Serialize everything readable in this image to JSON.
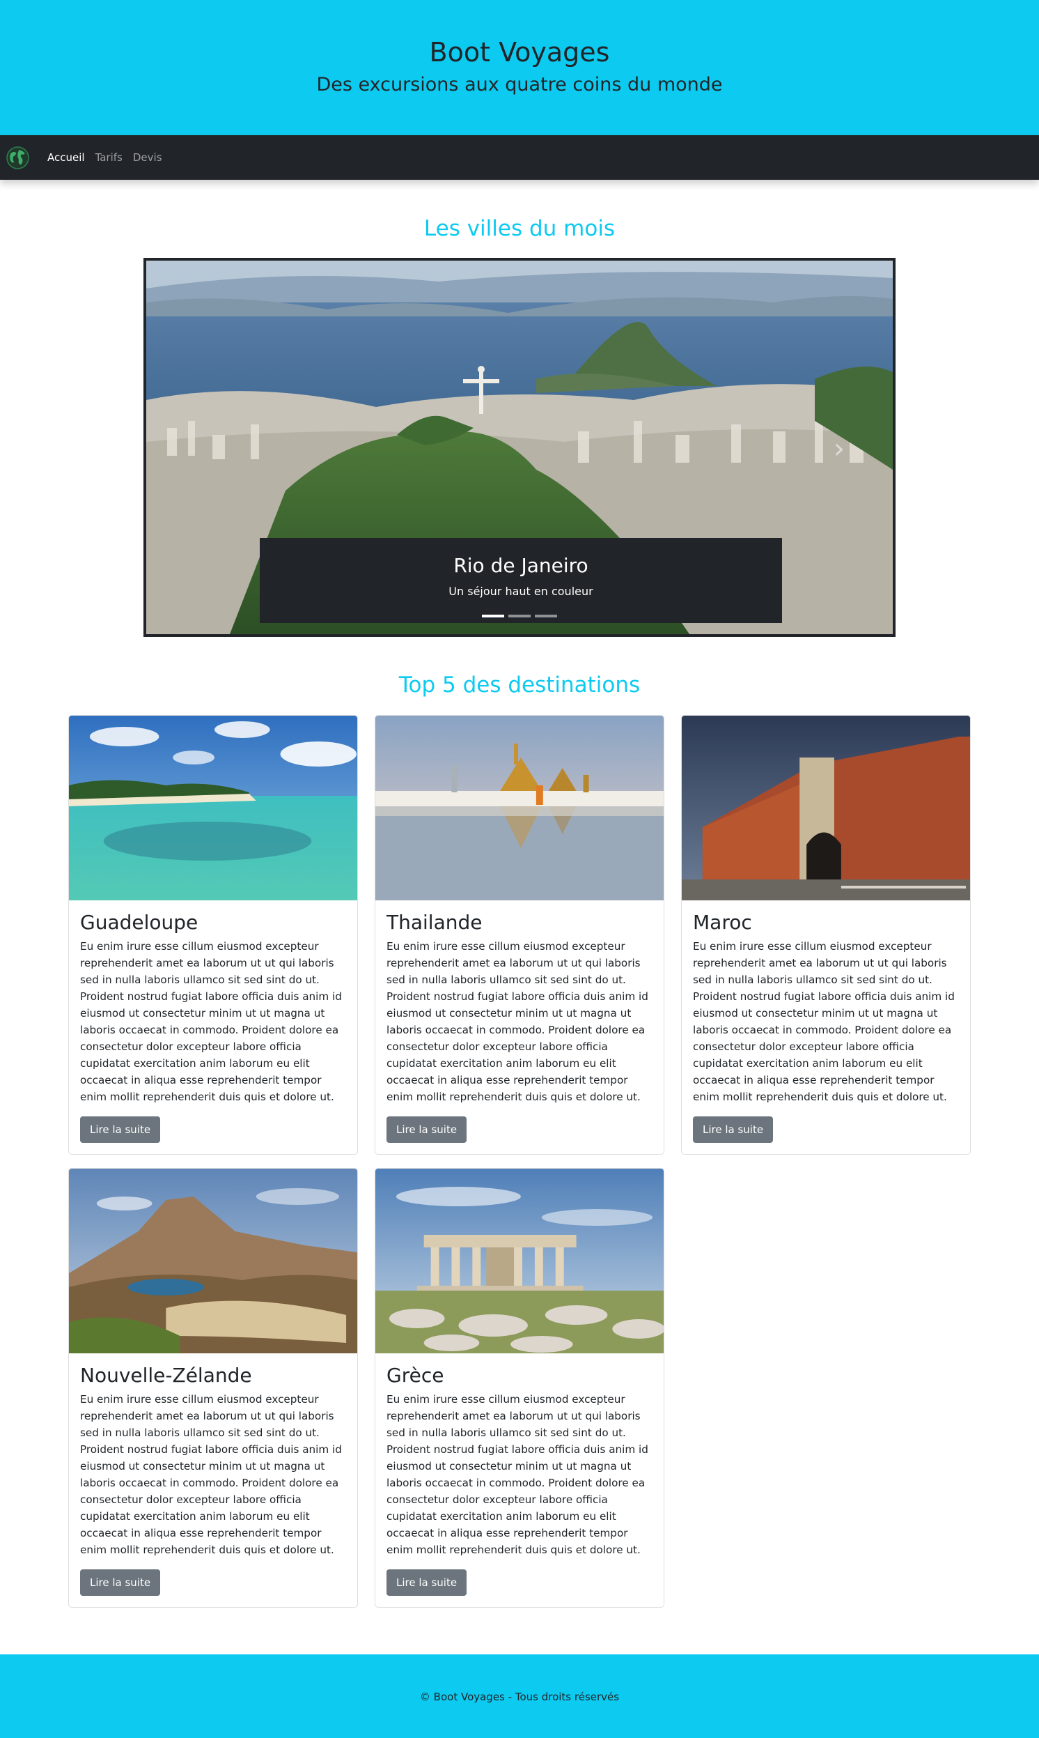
{
  "header": {
    "title": "Boot Voyages",
    "subtitle": "Des excursions aux quatre coins du monde"
  },
  "navbar": {
    "brand_icon": "globe-icon",
    "links": [
      {
        "label": "Accueil",
        "active": true
      },
      {
        "label": "Tarifs",
        "active": false
      },
      {
        "label": "Devis",
        "active": false
      }
    ]
  },
  "carousel_section": {
    "title": "Les villes du mois",
    "slide": {
      "image": "rio-de-janeiro-aerial-photo",
      "caption_title": "Rio de Janeiro",
      "caption_text": "Un séjour haut en couleur"
    },
    "indicator_count": 3,
    "active_indicator": 0
  },
  "destinations_section": {
    "title": "Top 5 des destinations",
    "cards": [
      {
        "title": "Guadeloupe",
        "image": "tropical-beach-photo",
        "text": "Eu enim irure esse cillum eiusmod excepteur reprehenderit amet ea laborum ut ut qui laboris sed in nulla laboris ullamco sit sed sint do ut. Proident nostrud fugiat labore officia duis anim id eiusmod ut consectetur minim ut ut magna ut laboris occaecat in commodo. Proident dolore ea consectetur dolor excepteur labore officia cupidatat exercitation anim laborum eu elit occaecat in aliqua esse reprehenderit tempor enim mollit reprehenderit duis quis et dolore ut.",
        "button": "Lire la suite"
      },
      {
        "title": "Thailande",
        "image": "thai-temple-reflection-photo",
        "text": "Eu enim irure esse cillum eiusmod excepteur reprehenderit amet ea laborum ut ut qui laboris sed in nulla laboris ullamco sit sed sint do ut. Proident nostrud fugiat labore officia duis anim id eiusmod ut consectetur minim ut ut magna ut laboris occaecat in commodo. Proident dolore ea consectetur dolor excepteur labore officia cupidatat exercitation anim laborum eu elit occaecat in aliqua esse reprehenderit tempor enim mollit reprehenderit duis quis et dolore ut.",
        "button": "Lire la suite"
      },
      {
        "title": "Maroc",
        "image": "moroccan-gate-photo",
        "text": "Eu enim irure esse cillum eiusmod excepteur reprehenderit amet ea laborum ut ut qui laboris sed in nulla laboris ullamco sit sed sint do ut. Proident nostrud fugiat labore officia duis anim id eiusmod ut consectetur minim ut ut magna ut laboris occaecat in commodo. Proident dolore ea consectetur dolor excepteur labore officia cupidatat exercitation anim laborum eu elit occaecat in aliqua esse reprehenderit tempor enim mollit reprehenderit duis quis et dolore ut.",
        "button": "Lire la suite"
      },
      {
        "title": "Nouvelle-Zélande",
        "image": "volcano-lake-photo",
        "text": "Eu enim irure esse cillum eiusmod excepteur reprehenderit amet ea laborum ut ut qui laboris sed in nulla laboris ullamco sit sed sint do ut. Proident nostrud fugiat labore officia duis anim id eiusmod ut consectetur minim ut ut magna ut laboris occaecat in commodo. Proident dolore ea consectetur dolor excepteur labore officia cupidatat exercitation anim laborum eu elit occaecat in aliqua esse reprehenderit tempor enim mollit reprehenderit duis quis et dolore ut.",
        "button": "Lire la suite"
      },
      {
        "title": "Grèce",
        "image": "acropolis-temple-photo",
        "text": "Eu enim irure esse cillum eiusmod excepteur reprehenderit amet ea laborum ut ut qui laboris sed in nulla laboris ullamco sit sed sint do ut. Proident nostrud fugiat labore officia duis anim id eiusmod ut consectetur minim ut ut magna ut laboris occaecat in commodo. Proident dolore ea consectetur dolor excepteur labore officia cupidatat exercitation anim laborum eu elit occaecat in aliqua esse reprehenderit tempor enim mollit reprehenderit duis quis et dolore ut.",
        "button": "Lire la suite"
      }
    ]
  },
  "footer": {
    "text": "© Boot Voyages - Tous droits réservés"
  },
  "colors": {
    "accent": "#0dcaf0",
    "navbar": "#212529",
    "button": "#6c757d"
  }
}
